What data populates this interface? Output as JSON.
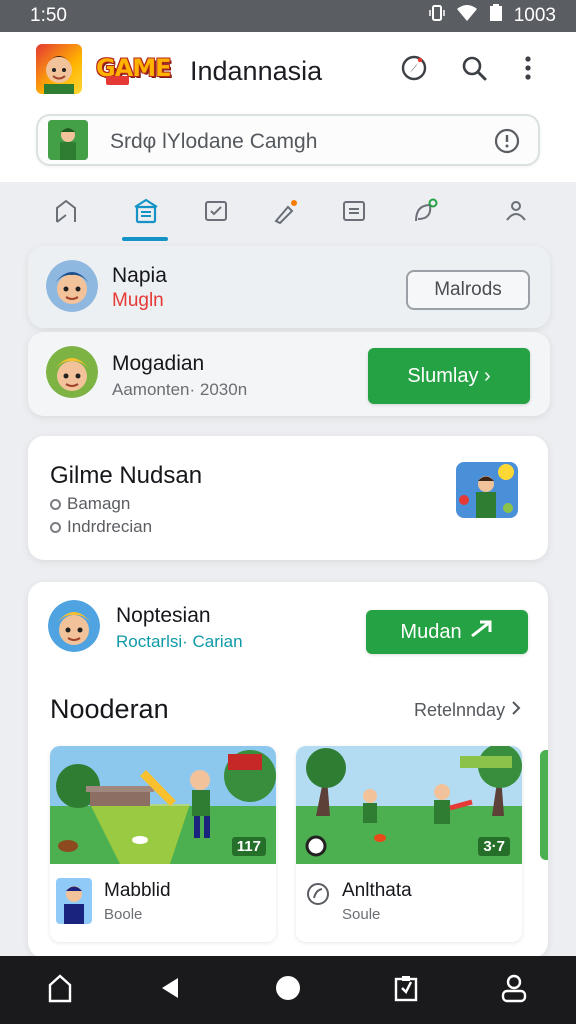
{
  "status_bar": {
    "time": "1:50",
    "battery_text": "1003"
  },
  "header": {
    "logo_text": "GAME",
    "title": "Indannasia",
    "actions": [
      {
        "icon": "compass-icon"
      },
      {
        "icon": "search-icon"
      },
      {
        "icon": "more-vert-icon"
      }
    ]
  },
  "search": {
    "placeholder": "Srdφ lYlodane Camgh"
  },
  "tabs": [
    {
      "icon": "home-icon",
      "active": false
    },
    {
      "icon": "list-icon",
      "active": true
    },
    {
      "icon": "chart-icon",
      "active": false
    },
    {
      "icon": "brush-icon",
      "active": false
    },
    {
      "icon": "document-icon",
      "active": false
    },
    {
      "icon": "leaf-icon",
      "active": false
    },
    {
      "icon": "person-icon",
      "active": false
    }
  ],
  "profile_card": {
    "name": "Napia",
    "subtitle": "Mugln",
    "button_label": "Malrods"
  },
  "match_card": {
    "name": "Mogadian",
    "subtitle": "Aamonten· 2030n",
    "button_label": "Slumlay ›"
  },
  "info_card": {
    "title": "Gilme Nudsan",
    "options": [
      "Bamagn",
      "Indrdrecian"
    ]
  },
  "feature_card": {
    "name": "Noptesian",
    "subtitle": "Roctarlsi· Carian",
    "button_label": "Mudan",
    "section_title": "Nooderan",
    "see_all_label": "Retelnnday",
    "games": [
      {
        "title": "Mabblid",
        "subtitle": "Boole",
        "score": "117"
      },
      {
        "title": "Anlthata",
        "subtitle": "Soule",
        "score": "3·7"
      }
    ]
  },
  "colors": {
    "accent": "#1593c7",
    "primary_green": "#25a244",
    "danger": "#e53935"
  }
}
